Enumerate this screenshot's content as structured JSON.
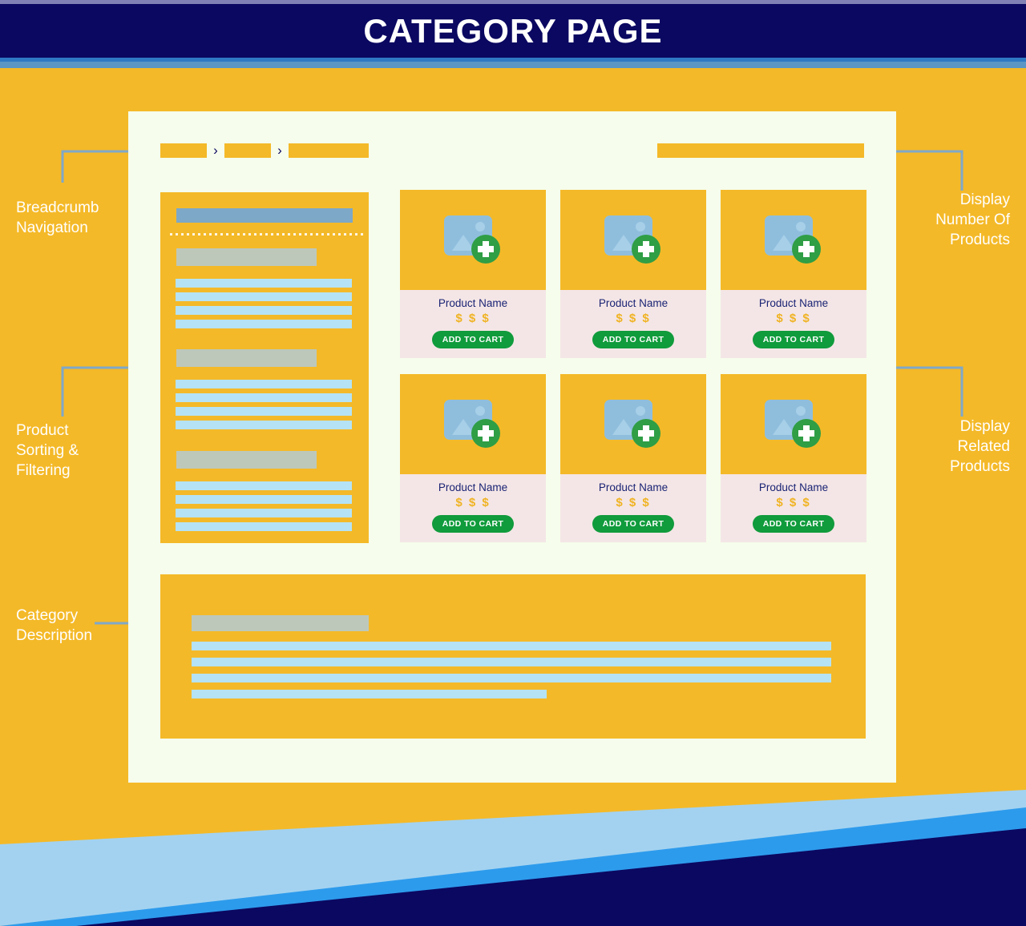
{
  "header": {
    "title": "CATEGORY PAGE",
    "colors": {
      "accent_top": "#8181b5",
      "navy": "#0b0861",
      "blue": "#2f79c4",
      "steel": "#5b96c4"
    }
  },
  "theme": {
    "page_background": "#f4b928",
    "panel_background": "#f6fdec",
    "placeholder_yellow": "#f4b928",
    "card_info_background": "#f4e6e6",
    "cart_button_green": "#109b3c",
    "price_yellow": "#f0b323",
    "product_name_navy": "#1a2374",
    "label_grey": "#bdc8bb",
    "line_blue": "#b5e3f5",
    "sidebar_header_blue": "#7da8c8",
    "connector_blue": "#7fa8c9"
  },
  "breadcrumb": {
    "name": "breadcrumb-navigation",
    "separator": "›",
    "items": [
      {
        "label": ""
      },
      {
        "label": ""
      },
      {
        "label": ""
      }
    ]
  },
  "product_count": {
    "label": ""
  },
  "sidebar": {
    "header_label": "",
    "sections": [
      {
        "label": "",
        "rows": [
          "",
          "",
          "",
          ""
        ]
      },
      {
        "label": "",
        "rows": [
          "",
          "",
          "",
          ""
        ]
      },
      {
        "label": "",
        "rows": [
          "",
          "",
          "",
          ""
        ]
      }
    ]
  },
  "products": {
    "image_icon": "image-placeholder-icon",
    "add_icon": "plus-circle-icon",
    "items": [
      {
        "name": "Product Name",
        "price": "$ $ $",
        "cart_label": "ADD TO CART"
      },
      {
        "name": "Product Name",
        "price": "$ $ $",
        "cart_label": "ADD TO CART"
      },
      {
        "name": "Product Name",
        "price": "$ $ $",
        "cart_label": "ADD TO CART"
      },
      {
        "name": "Product Name",
        "price": "$ $ $",
        "cart_label": "ADD TO CART"
      },
      {
        "name": "Product Name",
        "price": "$ $ $",
        "cart_label": "ADD TO CART"
      },
      {
        "name": "Product Name",
        "price": "$ $ $",
        "cart_label": "ADD TO CART"
      }
    ]
  },
  "description_block": {
    "title_label": "",
    "lines": [
      "",
      "",
      "",
      ""
    ]
  },
  "annotations": {
    "breadcrumb": "Breadcrumb\nNavigation",
    "sorting": "Product\nSorting &\nFiltering",
    "category_description": "Category\nDescription",
    "product_count": "Display\nNumber Of\nProducts",
    "related": "Display\nRelated\nProducts"
  }
}
